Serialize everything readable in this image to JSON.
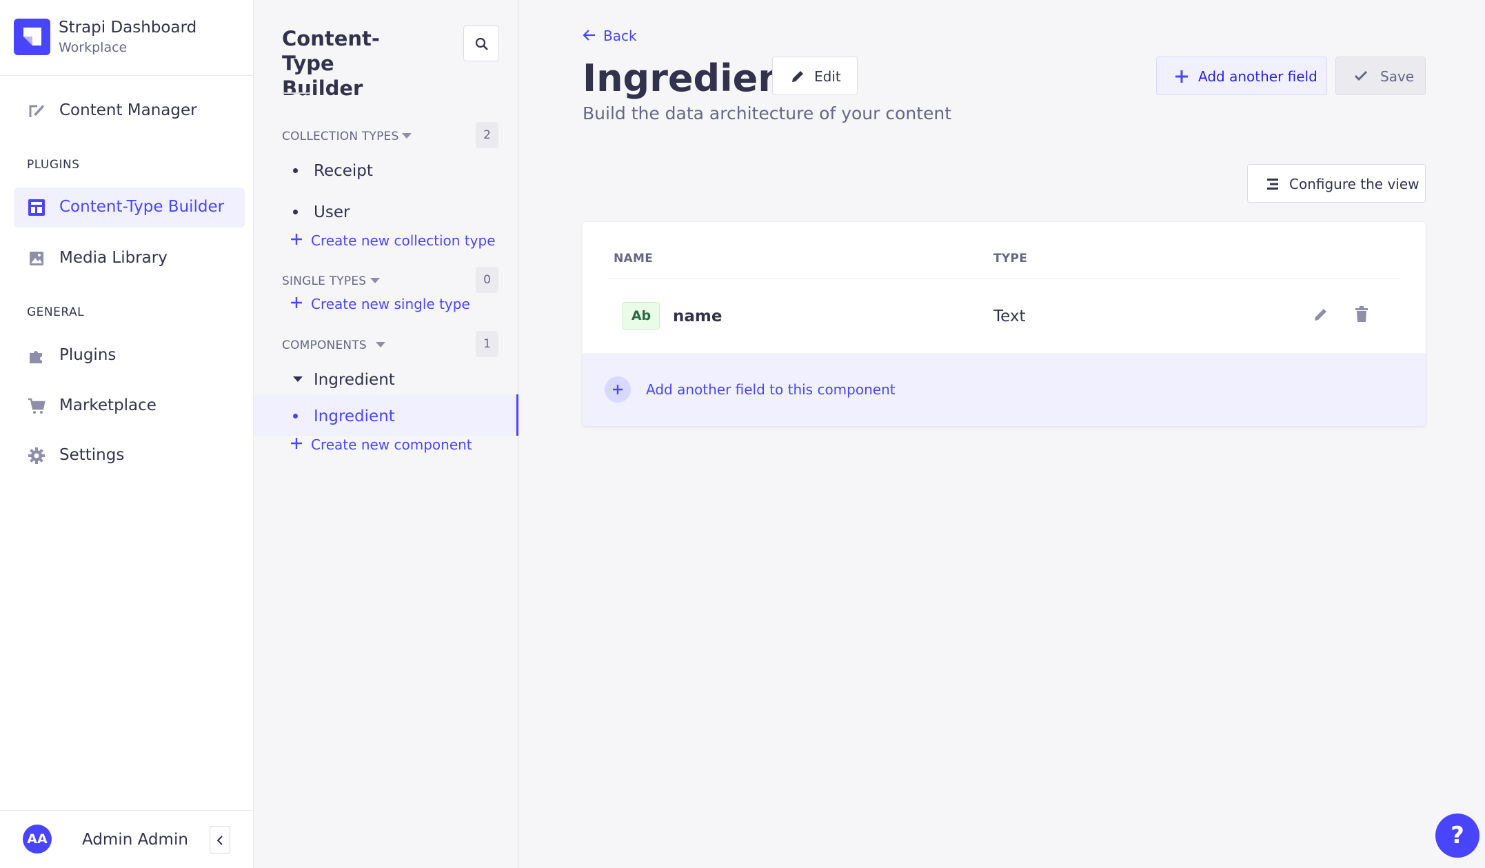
{
  "brand": {
    "title": "Strapi Dashboard",
    "subtitle": "Workplace"
  },
  "mainnav": {
    "content_manager": "Content Manager",
    "plugins_section": "PLUGINS",
    "ctb": "Content-Type Builder",
    "media_library": "Media Library",
    "general_section": "GENERAL",
    "plugins": "Plugins",
    "marketplace": "Marketplace",
    "settings": "Settings"
  },
  "user": {
    "initials": "AA",
    "name": "Admin Admin"
  },
  "subnav": {
    "title": "Content-Type Builder",
    "collection_types": {
      "heading": "COLLECTION TYPES",
      "count": "2",
      "items": [
        "Receipt",
        "User"
      ],
      "create": "Create new collection type"
    },
    "single_types": {
      "heading": "SINGLE TYPES",
      "count": "0",
      "create": "Create new single type"
    },
    "components": {
      "heading": "COMPONENTS",
      "count": "1",
      "category": "Ingredient",
      "items": [
        "Ingredient"
      ],
      "create": "Create new component"
    }
  },
  "main": {
    "back": "Back",
    "title": "Ingredient",
    "edit": "Edit",
    "subtitle": "Build the data architecture of your content",
    "add_field": "Add another field",
    "save": "Save",
    "configure_view": "Configure the view",
    "table": {
      "columns": [
        "NAME",
        "TYPE"
      ],
      "rows": [
        {
          "badge": "Ab",
          "name": "name",
          "type": "Text"
        }
      ]
    },
    "add_component_field": "Add another field to this component"
  },
  "help": "?",
  "colors": {
    "primary": "#4945ff",
    "primary_light": "#f0f0ff",
    "text": "#32324d",
    "muted": "#666687"
  }
}
